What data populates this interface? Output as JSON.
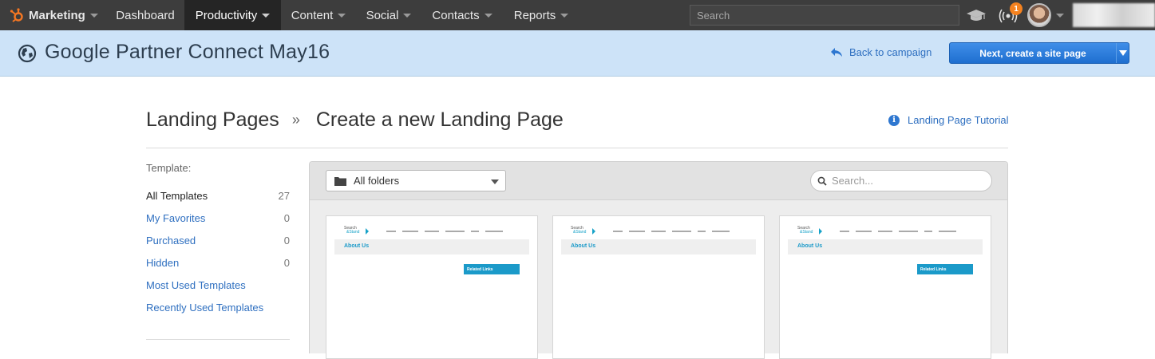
{
  "topnav": {
    "brand": "Marketing",
    "items": [
      {
        "label": "Dashboard",
        "has_menu": false
      },
      {
        "label": "Productivity",
        "has_menu": true,
        "active": true
      },
      {
        "label": "Content",
        "has_menu": true
      },
      {
        "label": "Social",
        "has_menu": true
      },
      {
        "label": "Contacts",
        "has_menu": true
      },
      {
        "label": "Reports",
        "has_menu": true
      }
    ],
    "search_placeholder": "Search",
    "notification_count": "1",
    "icons": [
      "hubspot-sprocket-icon",
      "graduation-cap-icon",
      "broadcast-icon",
      "avatar"
    ]
  },
  "campaign": {
    "title": "Google Partner Connect May16",
    "back_label": "Back to campaign",
    "next_label": "Next, create a site page"
  },
  "page": {
    "breadcrumb_parent": "Landing Pages",
    "breadcrumb_sep": "»",
    "breadcrumb_current": "Create a new Landing Page",
    "tutorial_label": "Landing Page Tutorial"
  },
  "sidebar": {
    "template_label": "Template:",
    "filters": [
      {
        "label": "All Templates",
        "count": "27",
        "active": true
      },
      {
        "label": "My Favorites",
        "count": "0"
      },
      {
        "label": "Purchased",
        "count": "0"
      },
      {
        "label": "Hidden",
        "count": "0"
      },
      {
        "label": "Most Used Templates",
        "count": ""
      },
      {
        "label": "Recently Used Templates",
        "count": ""
      }
    ]
  },
  "templates": {
    "folder_value": "All folders",
    "search_placeholder": "Search...",
    "cards": [
      {
        "logo_line1": "Search",
        "logo_line2": "&Stand",
        "heading": "About Us",
        "sidebar_label": "Related Links"
      },
      {
        "logo_line1": "Search",
        "logo_line2": "&Stand",
        "heading": "About Us",
        "sidebar_label": ""
      },
      {
        "logo_line1": "Search",
        "logo_line2": "&Stand",
        "heading": "About Us",
        "sidebar_label": "Related Links"
      }
    ]
  },
  "colors": {
    "topnav_bg": "#3d3d3d",
    "campaign_bg": "#cde3f8",
    "link": "#2e6fc0",
    "primary_button": "#2a7bdc",
    "badge": "#f5821f",
    "template_accent": "#1b9ac9"
  }
}
